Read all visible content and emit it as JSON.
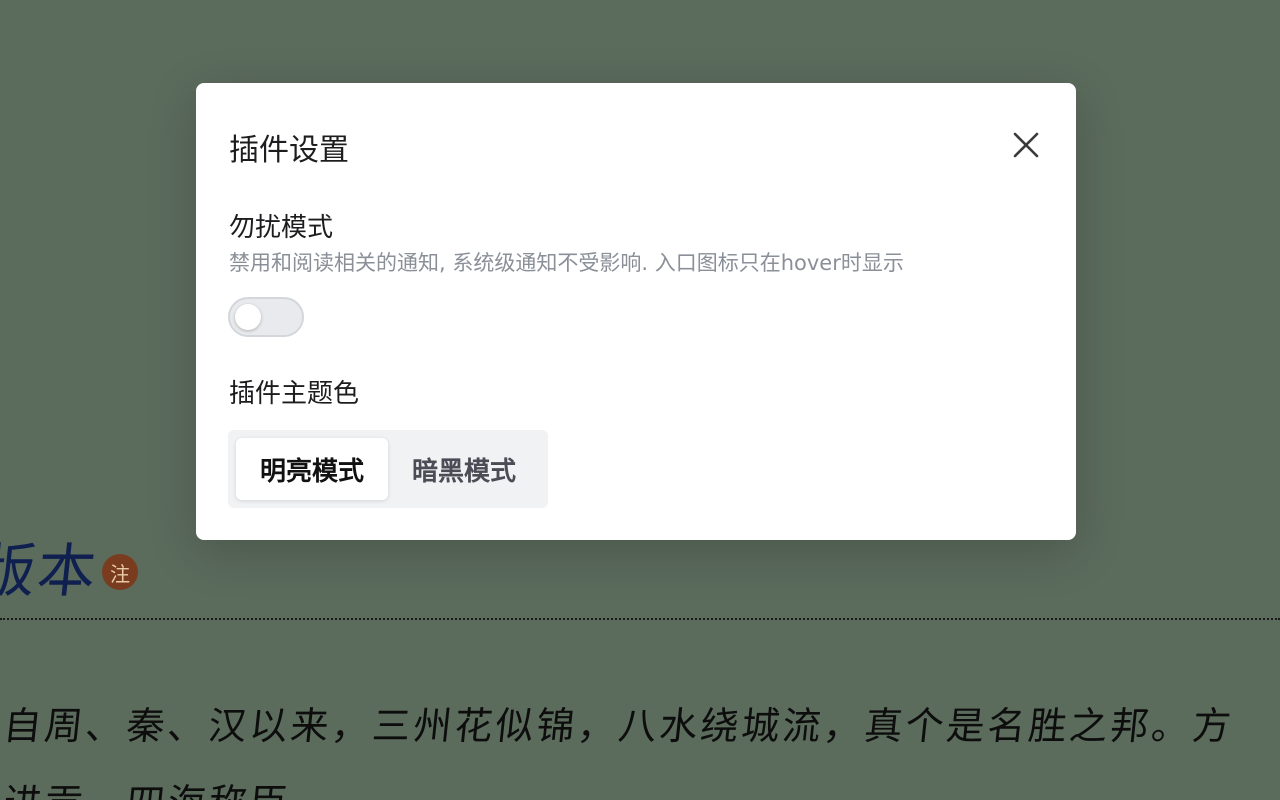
{
  "background": {
    "heading_fragment": "版本",
    "note_badge": "注",
    "lines": [
      "自周、秦、汉以来，三州花似锦，八水绕城流，真个是名胜之邦。方",
      "进贡，四海称臣"
    ]
  },
  "modal": {
    "title": "插件设置",
    "close_icon": "close-icon",
    "dnd": {
      "title": "勿扰模式",
      "description": "禁用和阅读相关的通知, 系统级通知不受影响. 入口图标只在hover时显示",
      "enabled": false
    },
    "theme": {
      "title": "插件主题色",
      "options": [
        "明亮模式",
        "暗黑模式"
      ],
      "selected": "明亮模式"
    }
  },
  "colors": {
    "backdrop": "#5b6b5c",
    "modal_bg": "#ffffff",
    "muted_text": "#8a8f98",
    "note_badge": "#7a3c1f"
  }
}
